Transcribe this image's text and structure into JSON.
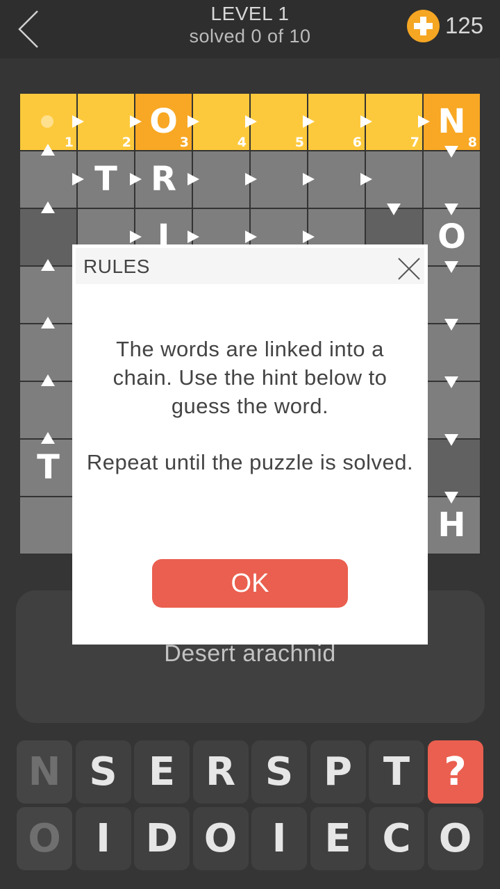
{
  "header": {
    "title": "LEVEL 1",
    "subtitle": "solved 0 of 10",
    "coins": "125",
    "back_icon": "chevron-left-icon",
    "coin_icon": "plus-coin-icon"
  },
  "colors": {
    "yellow": "#fdc93c",
    "orange": "#f8a824",
    "gray": "#7e7e7e",
    "dark_gray": "#616161",
    "accent_red": "#ea5f4f",
    "background": "#353535"
  },
  "board": {
    "rows": 8,
    "cols": 8,
    "cells": [
      {
        "r": 0,
        "c": 0,
        "style": "yellow",
        "letter": "",
        "num": "1",
        "dot": true
      },
      {
        "r": 0,
        "c": 1,
        "style": "yellow",
        "letter": "",
        "num": "2"
      },
      {
        "r": 0,
        "c": 2,
        "style": "orange",
        "letter": "O",
        "num": "3"
      },
      {
        "r": 0,
        "c": 3,
        "style": "yellow",
        "letter": "",
        "num": "4"
      },
      {
        "r": 0,
        "c": 4,
        "style": "yellow",
        "letter": "",
        "num": "5"
      },
      {
        "r": 0,
        "c": 5,
        "style": "yellow",
        "letter": "",
        "num": "6"
      },
      {
        "r": 0,
        "c": 6,
        "style": "yellow",
        "letter": "",
        "num": "7"
      },
      {
        "r": 0,
        "c": 7,
        "style": "orange",
        "letter": "N",
        "num": "8"
      },
      {
        "r": 1,
        "c": 0,
        "style": "gray",
        "letter": ""
      },
      {
        "r": 1,
        "c": 1,
        "style": "gray",
        "letter": "T"
      },
      {
        "r": 1,
        "c": 2,
        "style": "gray",
        "letter": "R"
      },
      {
        "r": 1,
        "c": 3,
        "style": "gray",
        "letter": ""
      },
      {
        "r": 1,
        "c": 4,
        "style": "gray",
        "letter": ""
      },
      {
        "r": 1,
        "c": 5,
        "style": "gray",
        "letter": ""
      },
      {
        "r": 1,
        "c": 6,
        "style": "gray",
        "letter": ""
      },
      {
        "r": 1,
        "c": 7,
        "style": "gray",
        "letter": ""
      },
      {
        "r": 2,
        "c": 0,
        "style": "dark",
        "letter": ""
      },
      {
        "r": 2,
        "c": 1,
        "style": "gray",
        "letter": ""
      },
      {
        "r": 2,
        "c": 2,
        "style": "gray",
        "letter": "I"
      },
      {
        "r": 2,
        "c": 3,
        "style": "gray",
        "letter": ""
      },
      {
        "r": 2,
        "c": 4,
        "style": "gray",
        "letter": ""
      },
      {
        "r": 2,
        "c": 5,
        "style": "gray",
        "letter": ""
      },
      {
        "r": 2,
        "c": 6,
        "style": "dark",
        "letter": ""
      },
      {
        "r": 2,
        "c": 7,
        "style": "gray",
        "letter": "O"
      },
      {
        "r": 3,
        "c": 0,
        "style": "gray",
        "letter": ""
      },
      {
        "r": 3,
        "c": 7,
        "style": "gray",
        "letter": ""
      },
      {
        "r": 4,
        "c": 0,
        "style": "gray",
        "letter": ""
      },
      {
        "r": 4,
        "c": 7,
        "style": "gray",
        "letter": ""
      },
      {
        "r": 5,
        "c": 0,
        "style": "gray",
        "letter": ""
      },
      {
        "r": 5,
        "c": 7,
        "style": "gray",
        "letter": ""
      },
      {
        "r": 6,
        "c": 0,
        "style": "gray",
        "letter": "T"
      },
      {
        "r": 6,
        "c": 7,
        "style": "dark",
        "letter": ""
      },
      {
        "r": 7,
        "c": 0,
        "style": "gray",
        "letter": ""
      },
      {
        "r": 7,
        "c": 7,
        "style": "gray",
        "letter": "H"
      }
    ],
    "arrows": [
      {
        "r": 0,
        "c": 0,
        "dir": "right"
      },
      {
        "r": 0,
        "c": 1,
        "dir": "right"
      },
      {
        "r": 0,
        "c": 2,
        "dir": "right"
      },
      {
        "r": 0,
        "c": 3,
        "dir": "right"
      },
      {
        "r": 0,
        "c": 4,
        "dir": "right"
      },
      {
        "r": 0,
        "c": 5,
        "dir": "right"
      },
      {
        "r": 0,
        "c": 6,
        "dir": "right"
      },
      {
        "r": 0,
        "c": 7,
        "dir": "down"
      },
      {
        "r": 1,
        "c": 0,
        "dir": "right"
      },
      {
        "r": 1,
        "c": 1,
        "dir": "right"
      },
      {
        "r": 1,
        "c": 2,
        "dir": "right"
      },
      {
        "r": 1,
        "c": 3,
        "dir": "right"
      },
      {
        "r": 1,
        "c": 4,
        "dir": "right"
      },
      {
        "r": 1,
        "c": 5,
        "dir": "right"
      },
      {
        "r": 1,
        "c": 6,
        "dir": "down"
      },
      {
        "r": 1,
        "c": 7,
        "dir": "down"
      },
      {
        "r": 2,
        "c": 1,
        "dir": "right"
      },
      {
        "r": 2,
        "c": 2,
        "dir": "right"
      },
      {
        "r": 2,
        "c": 3,
        "dir": "right"
      },
      {
        "r": 2,
        "c": 4,
        "dir": "right"
      },
      {
        "r": 2,
        "c": 7,
        "dir": "down"
      },
      {
        "r": 3,
        "c": 7,
        "dir": "down"
      },
      {
        "r": 4,
        "c": 7,
        "dir": "down"
      },
      {
        "r": 5,
        "c": 7,
        "dir": "down"
      },
      {
        "r": 6,
        "c": 7,
        "dir": "down"
      },
      {
        "r": 1,
        "c": 0,
        "dir": "up"
      },
      {
        "r": 2,
        "c": 0,
        "dir": "up"
      },
      {
        "r": 3,
        "c": 0,
        "dir": "up"
      },
      {
        "r": 4,
        "c": 0,
        "dir": "up"
      },
      {
        "r": 5,
        "c": 0,
        "dir": "up"
      },
      {
        "r": 6,
        "c": 0,
        "dir": "up"
      }
    ]
  },
  "hint": {
    "text": "Desert arachnid"
  },
  "keyboard": {
    "rows": [
      [
        {
          "label": "N",
          "used": true
        },
        {
          "label": "S"
        },
        {
          "label": "E"
        },
        {
          "label": "R"
        },
        {
          "label": "S"
        },
        {
          "label": "P"
        },
        {
          "label": "T"
        },
        {
          "label": "?",
          "hint": true
        }
      ],
      [
        {
          "label": "O",
          "used": true
        },
        {
          "label": "I"
        },
        {
          "label": "D"
        },
        {
          "label": "O"
        },
        {
          "label": "I"
        },
        {
          "label": "E"
        },
        {
          "label": "C"
        },
        {
          "label": "O"
        }
      ]
    ]
  },
  "dialog": {
    "title": "RULES",
    "paragraph1": "The words are linked into a chain. Use the hint below to guess the word.",
    "paragraph2": "Repeat until the puzzle is solved.",
    "ok_label": "OK",
    "close_icon": "close-icon"
  }
}
